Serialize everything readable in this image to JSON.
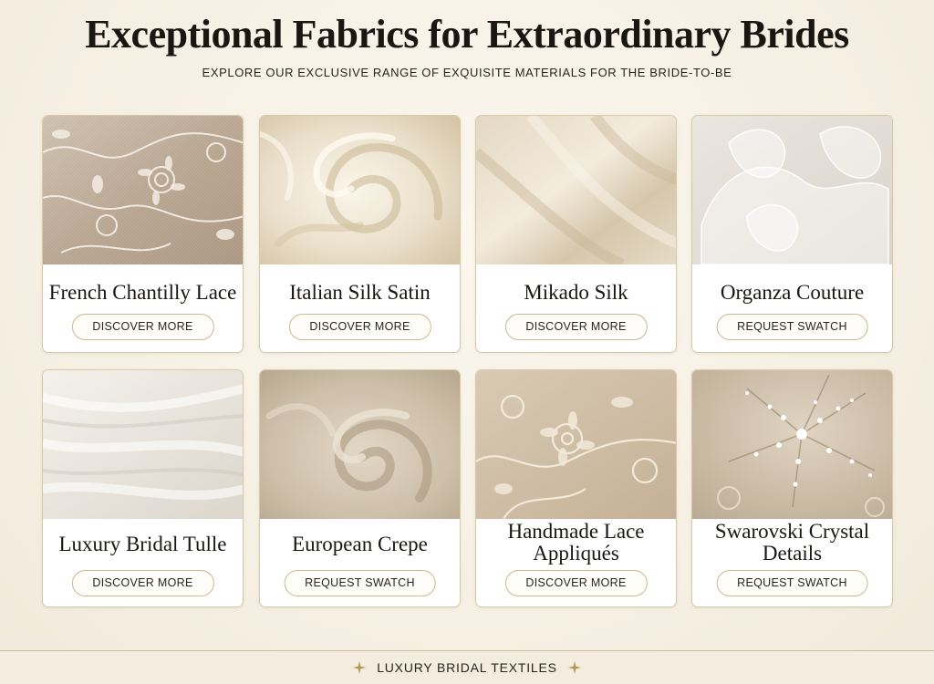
{
  "header": {
    "title": "Exceptional Fabrics for Extraordinary Brides",
    "subtitle": "EXPLORE OUR EXCLUSIVE RANGE OF EXQUISITE MATERIALS FOR THE BRIDE-TO-BE"
  },
  "fabrics": [
    {
      "name": "French Chantilly Lace",
      "button": "DISCOVER MORE"
    },
    {
      "name": "Italian Silk Satin",
      "button": "DISCOVER MORE"
    },
    {
      "name": "Mikado Silk",
      "button": "DISCOVER MORE"
    },
    {
      "name": "Organza Couture",
      "button": "REQUEST SWATCH"
    },
    {
      "name": "Luxury Bridal Tulle",
      "button": "DISCOVER MORE"
    },
    {
      "name": "European Crepe",
      "button": "REQUEST SWATCH"
    },
    {
      "name": "Handmade Lace Appliqués",
      "button": "DISCOVER MORE"
    },
    {
      "name": "Swarovski Crystal Details",
      "button": "REQUEST SWATCH"
    }
  ],
  "footer": {
    "label": "LUXURY BRIDAL TEXTILES",
    "icon": "sparkle-icon"
  },
  "colors": {
    "background": "#f7f1e6",
    "card_border": "#d9c9a8",
    "button_border": "#cdb892",
    "accent_gold": "#b8985a"
  }
}
